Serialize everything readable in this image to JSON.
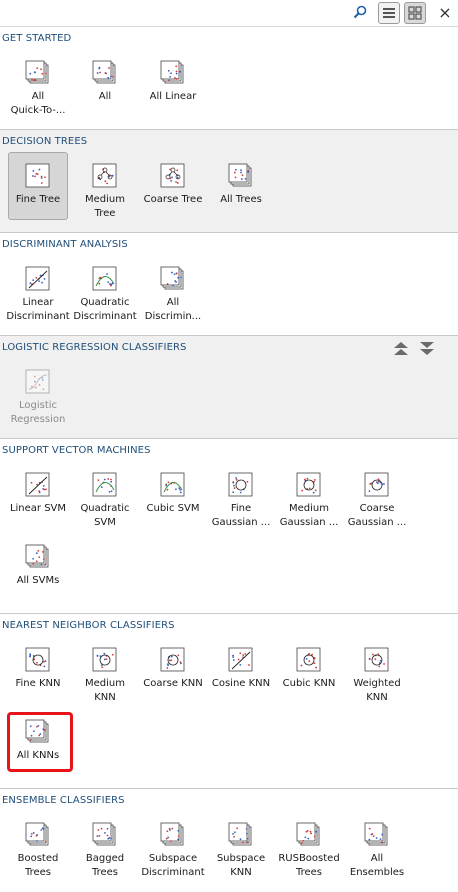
{
  "search": {
    "placeholder": "",
    "value": ""
  },
  "toolbar": {
    "close_label": "×"
  },
  "sections": {
    "get_started": {
      "title": "GET STARTED",
      "items": [
        {
          "label_lines": [
            "All",
            "Quick-To-..."
          ]
        },
        {
          "label_lines": [
            "All"
          ]
        },
        {
          "label_lines": [
            "All Linear"
          ]
        }
      ]
    },
    "decision_trees": {
      "title": "DECISION TREES",
      "items": [
        {
          "label_lines": [
            "Fine Tree"
          ],
          "selected": true
        },
        {
          "label_lines": [
            "Medium",
            "Tree"
          ]
        },
        {
          "label_lines": [
            "Coarse Tree"
          ]
        },
        {
          "label_lines": [
            "All Trees"
          ]
        }
      ]
    },
    "discriminant": {
      "title": "DISCRIMINANT ANALYSIS",
      "items": [
        {
          "label_lines": [
            "Linear",
            "Discriminant"
          ]
        },
        {
          "label_lines": [
            "Quadratic",
            "Discriminant"
          ]
        },
        {
          "label_lines": [
            "All",
            "Discrimin..."
          ]
        }
      ]
    },
    "logistic": {
      "title": "LOGISTIC REGRESSION CLASSIFIERS",
      "items": [
        {
          "label_lines": [
            "Logistic",
            "Regression"
          ],
          "disabled": true
        }
      ]
    },
    "svm": {
      "title": "SUPPORT VECTOR MACHINES",
      "items": [
        {
          "label_lines": [
            "Linear SVM"
          ]
        },
        {
          "label_lines": [
            "Quadratic",
            "SVM"
          ]
        },
        {
          "label_lines": [
            "Cubic SVM"
          ]
        },
        {
          "label_lines": [
            "Fine",
            "Gaussian ..."
          ]
        },
        {
          "label_lines": [
            "Medium",
            "Gaussian ..."
          ]
        },
        {
          "label_lines": [
            "Coarse",
            "Gaussian ..."
          ]
        },
        {
          "label_lines": [
            "All SVMs"
          ]
        }
      ]
    },
    "knn": {
      "title": "NEAREST NEIGHBOR CLASSIFIERS",
      "items": [
        {
          "label_lines": [
            "Fine KNN"
          ]
        },
        {
          "label_lines": [
            "Medium",
            "KNN"
          ]
        },
        {
          "label_lines": [
            "Coarse KNN"
          ]
        },
        {
          "label_lines": [
            "Cosine KNN"
          ]
        },
        {
          "label_lines": [
            "Cubic KNN"
          ]
        },
        {
          "label_lines": [
            "Weighted",
            "KNN"
          ]
        },
        {
          "label_lines": [
            "All KNNs"
          ],
          "highlighted": true
        }
      ]
    },
    "ensemble": {
      "title": "ENSEMBLE CLASSIFIERS",
      "items": [
        {
          "label_lines": [
            "Boosted",
            "Trees"
          ]
        },
        {
          "label_lines": [
            "Bagged",
            "Trees"
          ]
        },
        {
          "label_lines": [
            "Subspace",
            "Discriminant"
          ]
        },
        {
          "label_lines": [
            "Subspace",
            "KNN"
          ]
        },
        {
          "label_lines": [
            "RUSBoosted",
            "Trees"
          ]
        },
        {
          "label_lines": [
            "All",
            "Ensembles"
          ]
        }
      ]
    }
  },
  "colors": {
    "header_text": "#1f4e79",
    "highlight": "#e8141b",
    "section_bg": "#f0f0f0"
  },
  "icons": {
    "search": "search-icon",
    "list_view": "list-view-icon",
    "grid_view": "grid-view-icon",
    "close": "close-icon",
    "collapse_all": "collapse-all-icon",
    "expand_all": "expand-all-icon"
  }
}
